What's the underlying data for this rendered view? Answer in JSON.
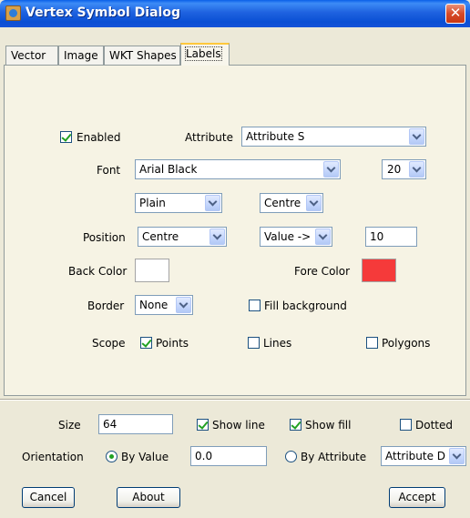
{
  "window": {
    "title": "Vertex Symbol Dialog",
    "title_icon": "java-cup-icon",
    "close_icon": "close-icon",
    "close_glyph": "✕"
  },
  "tabs": [
    {
      "label": "Vector",
      "active": false
    },
    {
      "label": "Image",
      "active": false
    },
    {
      "label": "WKT Shapes",
      "active": false
    },
    {
      "label": "Labels",
      "active": true
    }
  ],
  "labels_tab": {
    "enabled": {
      "label": "Enabled",
      "checked": true
    },
    "attribute": {
      "label": "Attribute",
      "value": "Attribute S"
    },
    "font": {
      "label": "Font",
      "value": "Arial Black",
      "size": "20"
    },
    "style": {
      "value": "Plain"
    },
    "alignment": {
      "value": "Centre"
    },
    "position": {
      "label": "Position",
      "value": "Centre",
      "mode": "Value ->",
      "amount": "10"
    },
    "back_color": {
      "label": "Back Color",
      "color": "#FFFFFF"
    },
    "fore_color": {
      "label": "Fore Color",
      "color": "#F53A3A"
    },
    "border": {
      "label": "Border",
      "value": "None"
    },
    "fill_background": {
      "label": "Fill background",
      "checked": false
    },
    "scope": {
      "label": "Scope",
      "points": {
        "label": "Points",
        "checked": true
      },
      "lines": {
        "label": "Lines",
        "checked": false
      },
      "polygons": {
        "label": "Polygons",
        "checked": false
      }
    }
  },
  "bottom": {
    "size": {
      "label": "Size",
      "value": "64"
    },
    "show_line": {
      "label": "Show line",
      "checked": true
    },
    "show_fill": {
      "label": "Show fill",
      "checked": true
    },
    "dotted": {
      "label": "Dotted",
      "checked": false
    },
    "orientation": {
      "label": "Orientation",
      "by_value": {
        "label": "By Value",
        "selected": true
      },
      "value": "0.0",
      "by_attribute": {
        "label": "By Attribute",
        "selected": false
      },
      "attribute": "Attribute D"
    }
  },
  "buttons": {
    "cancel": "Cancel",
    "about": "About",
    "accept": "Accept"
  }
}
